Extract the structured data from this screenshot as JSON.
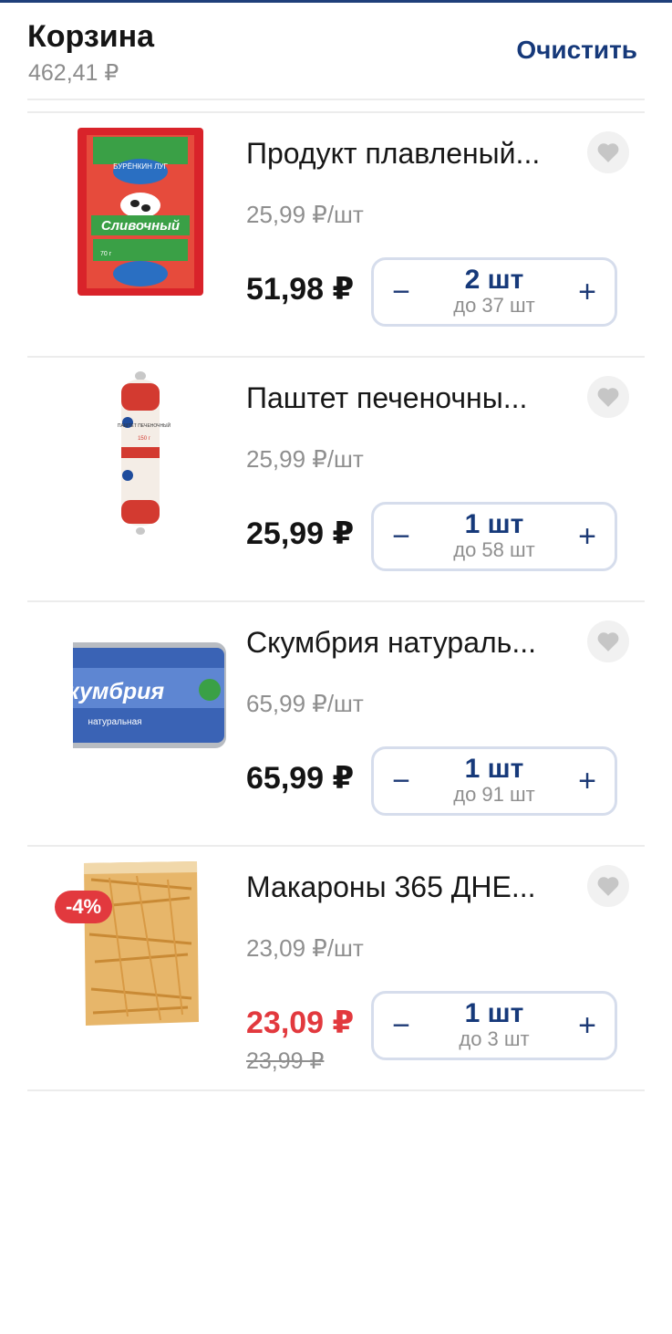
{
  "header": {
    "title": "Корзина",
    "total": "462,41 ₽",
    "clear_label": "Очистить"
  },
  "items": [
    {
      "title": "Продукт плавленый...",
      "unit_price": "25,99 ₽/шт",
      "price": "51,98 ₽",
      "qty": "2 шт",
      "qty_max": "до 37 шт",
      "image": "cheese-pack",
      "pack_text": [
        "БУРЁНКИН ЛУГ",
        "Сливочный",
        "70 г"
      ]
    },
    {
      "title": "Паштет печеночны...",
      "unit_price": "25,99 ₽/шт",
      "price": "25,99 ₽",
      "qty": "1 шт",
      "qty_max": "до 58 шт",
      "image": "pate-tube",
      "pack_text": [
        "ПАШТЕТ ПЕЧЕНОЧНЫЙ",
        "150 г"
      ]
    },
    {
      "title": "Скумбрия натураль...",
      "unit_price": "65,99 ₽/шт",
      "price": "65,99 ₽",
      "qty": "1 шт",
      "qty_max": "до 91 шт",
      "image": "fish-can",
      "pack_text": [
        "Скумбрия",
        "натуральная"
      ]
    },
    {
      "title": "Макароны 365 ДНЕ...",
      "unit_price": "23,09 ₽/шт",
      "price": "23,09 ₽",
      "old_price": "23,99 ₽",
      "discount": "-4%",
      "qty": "1 шт",
      "qty_max": "до 3 шт",
      "image": "pasta-bag"
    }
  ],
  "colors": {
    "accent": "#16397a",
    "sale": "#e2393e",
    "muted": "#8f8f8f"
  }
}
